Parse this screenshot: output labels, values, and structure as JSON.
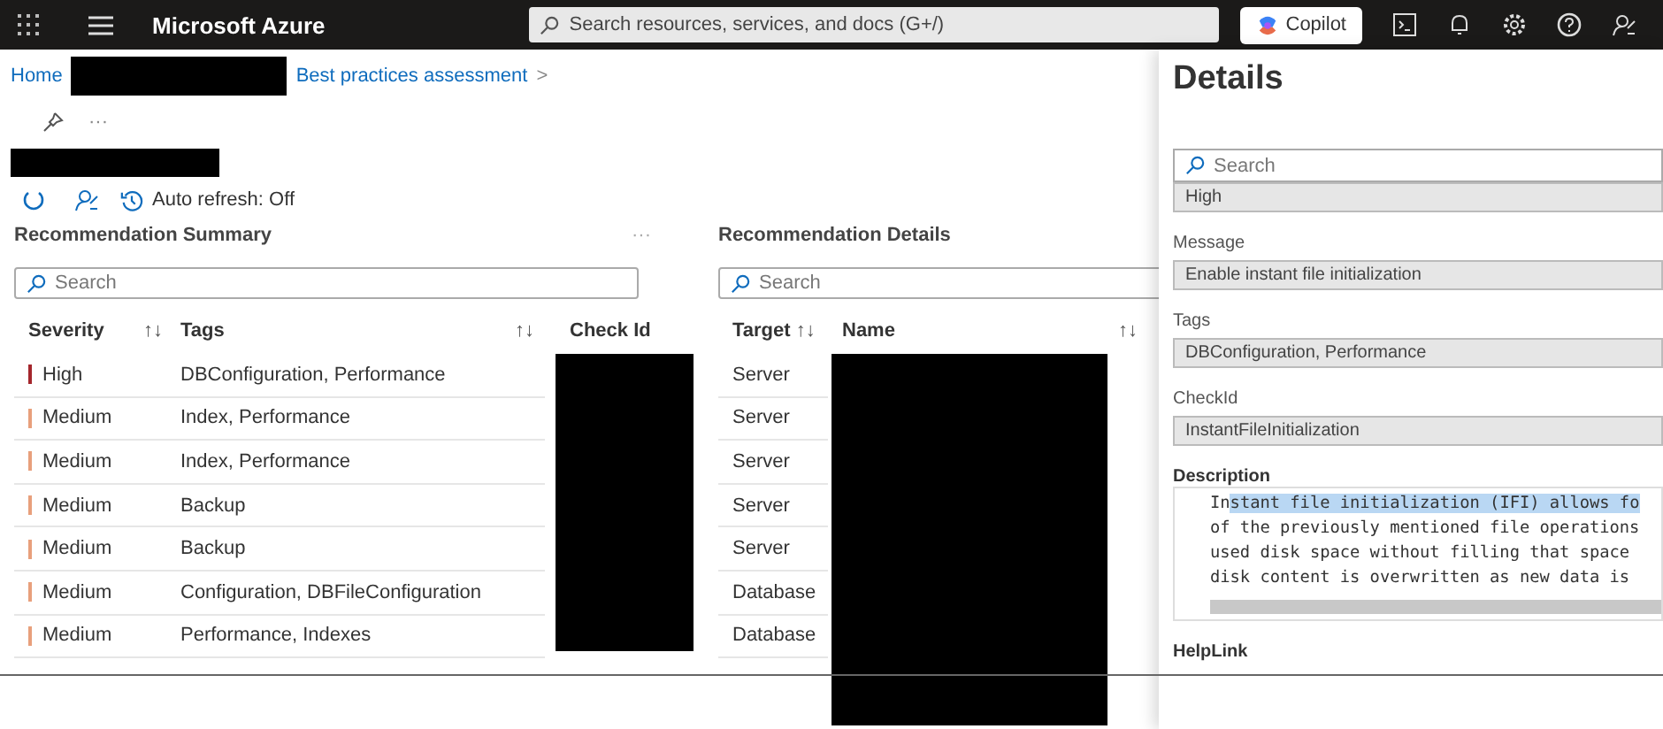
{
  "topbar": {
    "brand": "Microsoft Azure",
    "search": {
      "placeholder": "Search resources, services, and docs (G+/)"
    },
    "copilot": "Copilot"
  },
  "breadcrumb": {
    "home": "Home",
    "current": "Best practices assessment",
    "separator": ">"
  },
  "more": "···",
  "toolbar": {
    "auto_refresh": "Auto refresh: Off"
  },
  "summary": {
    "title": "Recommendation Summary",
    "more": "···",
    "search": {
      "placeholder": "Search"
    },
    "columns": [
      {
        "label": "Severity",
        "sort": "↑↓"
      },
      {
        "label": "Tags",
        "sort": "↑↓"
      },
      {
        "label": "Check Id"
      }
    ],
    "rows": [
      {
        "severity": "High",
        "tags": "DBConfiguration, Performance",
        "color": "#a4262c"
      },
      {
        "severity": "Medium",
        "tags": "Index, Performance",
        "color": "#e8a07c"
      },
      {
        "severity": "Medium",
        "tags": "Index, Performance",
        "color": "#e8a07c"
      },
      {
        "severity": "Medium",
        "tags": "Backup",
        "color": "#e8a07c"
      },
      {
        "severity": "Medium",
        "tags": "Backup",
        "color": "#e8a07c"
      },
      {
        "severity": "Medium",
        "tags": "Configuration, DBFileConfiguration",
        "color": "#e8a07c"
      },
      {
        "severity": "Medium",
        "tags": "Performance, Indexes",
        "color": "#e8a07c"
      }
    ]
  },
  "details_list": {
    "title": "Recommendation Details",
    "search": {
      "placeholder": "Search"
    },
    "columns": [
      {
        "label": "Target",
        "sort": "↑↓"
      },
      {
        "label": "Name",
        "sort": "↑↓"
      }
    ],
    "rows": [
      {
        "target": "Server"
      },
      {
        "target": "Server"
      },
      {
        "target": "Server"
      },
      {
        "target": "Server"
      },
      {
        "target": "Server"
      },
      {
        "target": "Database"
      },
      {
        "target": "Database"
      }
    ]
  },
  "details": {
    "title": "Details",
    "search": {
      "placeholder": "Search"
    },
    "severity_value": "High",
    "fields": [
      {
        "label": "Message",
        "value": "Enable instant file initialization"
      },
      {
        "label": "Tags",
        "value": "DBConfiguration, Performance"
      },
      {
        "label": "CheckId",
        "value": "InstantFileInitialization"
      }
    ],
    "description": {
      "label": "Description",
      "lines": [
        [
          {
            "text": "In",
            "selected": false
          },
          {
            "text": "stant file initialization (IFI) allows fo",
            "selected": true
          }
        ],
        [
          {
            "text": "of the previously mentioned file operations",
            "selected": false
          }
        ],
        [
          {
            "text": "used disk space without filling that space",
            "selected": false
          }
        ],
        [
          {
            "text": "disk content is overwritten as new data is",
            "selected": false
          }
        ]
      ]
    },
    "helplink": {
      "label": "HelpLink"
    }
  }
}
